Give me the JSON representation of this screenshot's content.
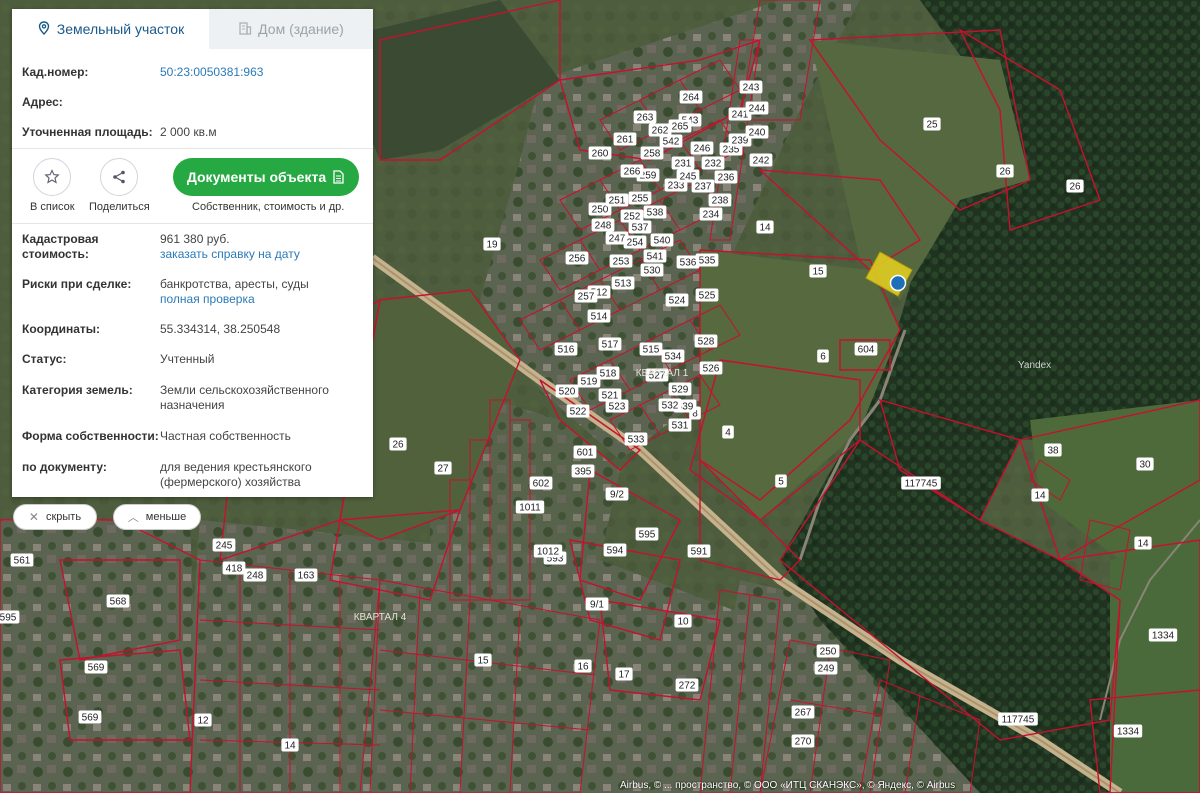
{
  "tabs": {
    "land": "Земельный участок",
    "building": "Дом (здание)"
  },
  "info": {
    "cad_label": "Кад.номер:",
    "cad_value": "50:23:0050381:963",
    "address_label": "Адрес:",
    "address_value": "",
    "area_label": "Уточненная площадь:",
    "area_value": "2 000 кв.м"
  },
  "actions": {
    "list": "В список",
    "share": "Поделиться",
    "docs_button": "Документы объекта",
    "docs_sub": "Собственник, стоимость и др."
  },
  "details": {
    "cost_label_1": "Кадастровая",
    "cost_label_2": "стоимость:",
    "cost_value": "961 380 руб.",
    "cost_link": "заказать справку на дату",
    "risk_label": "Риски при сделке:",
    "risk_value": "банкротства, аресты, суды",
    "risk_link": "полная проверка",
    "coords_label": "Координаты:",
    "coords_value": "55.334314, 38.250548",
    "status_label": "Статус:",
    "status_value": "Учтенный",
    "category_label": "Категория земель:",
    "category_value_1": "Земли сельскохозяйственного",
    "category_value_2": "назначения",
    "ownership_label": "Форма собственности:",
    "ownership_value": "Частная собственность",
    "doc_label": "по документу:",
    "doc_value_1": "для ведения крестьянского",
    "doc_value_2": "(фермерского) хозяйства"
  },
  "buttons": {
    "hide": "скрыть",
    "less": "меньше"
  },
  "attribution": "Airbus, © ... пространство, © ООО «ИТЦ СКАНЭКС», © Яндекс, © Airbus",
  "map": {
    "watermark": "Yandex",
    "labels": [
      "25",
      "26",
      "26",
      "19",
      "14",
      "15",
      "6",
      "604",
      "4",
      "5",
      "117745",
      "117745",
      "30",
      "14",
      "14",
      "38",
      "1334",
      "1334",
      "26",
      "27",
      "9/2",
      "9/1",
      "10",
      "591",
      "593",
      "594",
      "595",
      "1012",
      "1011",
      "602",
      "395",
      "601",
      "561",
      "568",
      "569",
      "569",
      "595",
      "245",
      "418",
      "248",
      "163",
      "250",
      "249",
      "267",
      "270",
      "272",
      "17",
      "16",
      "15",
      "14",
      "12",
      "8",
      "539",
      "528",
      "530",
      "512",
      "513",
      "514",
      "515",
      "516",
      "517",
      "518",
      "519",
      "520",
      "521",
      "522",
      "523",
      "524",
      "525",
      "526",
      "527",
      "529",
      "531",
      "532",
      "533",
      "534",
      "535",
      "536",
      "537",
      "538",
      "540",
      "541",
      "542",
      "543",
      "231",
      "232",
      "233",
      "234",
      "235",
      "236",
      "237",
      "238",
      "239",
      "240",
      "241",
      "242",
      "243",
      "244",
      "245",
      "246",
      "247",
      "248",
      "250",
      "251",
      "252",
      "253",
      "254",
      "255",
      "256",
      "257",
      "258",
      "259",
      "260",
      "261",
      "262",
      "263",
      "264",
      "265",
      "266"
    ],
    "quarter_labels": [
      "КВАРТАЛ 1",
      "КВАРТАЛ 4"
    ],
    "colors": {
      "boundary": "#c8102e",
      "highlight": "#e8d320",
      "marker": "#1c6fb8",
      "forest": "#243a22",
      "field": "#4a5a3a"
    }
  }
}
